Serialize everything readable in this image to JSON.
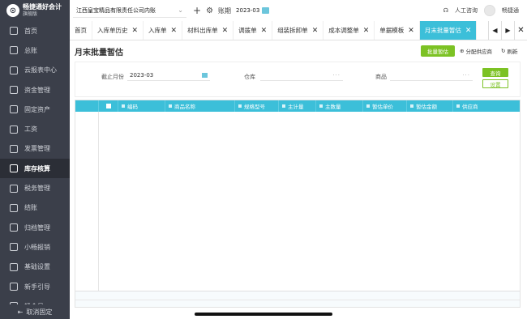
{
  "app": {
    "name": "畅捷通好会计",
    "edition": "旗舰版"
  },
  "sidebar": {
    "items": [
      {
        "label": "首页",
        "icon": "home-icon"
      },
      {
        "label": "总账",
        "icon": "ledger-icon"
      },
      {
        "label": "云报表中心",
        "icon": "report-icon"
      },
      {
        "label": "资金管理",
        "icon": "fund-icon"
      },
      {
        "label": "固定资产",
        "icon": "asset-icon"
      },
      {
        "label": "工资",
        "icon": "salary-icon"
      },
      {
        "label": "发票管理",
        "icon": "invoice-icon"
      },
      {
        "label": "库存核算",
        "icon": "inventory-icon"
      },
      {
        "label": "税务管理",
        "icon": "tax-icon"
      },
      {
        "label": "结账",
        "icon": "closing-icon"
      },
      {
        "label": "归档管理",
        "icon": "archive-icon"
      },
      {
        "label": "小畅报销",
        "icon": "reimburse-icon"
      },
      {
        "label": "基础设置",
        "icon": "settings-icon"
      },
      {
        "label": "新手引导",
        "icon": "guide-icon"
      },
      {
        "label": "畅会员",
        "icon": "member-icon"
      }
    ],
    "active_index": 7,
    "unpin_label": "取消固定"
  },
  "topbar": {
    "company": "江西皇宝精品有限责任公司内账",
    "period_label": "账期",
    "period_value": "2023-03",
    "support_label": "人工咨询",
    "user_name": "畅捷通"
  },
  "tabs": [
    {
      "label": "首页",
      "closable": false
    },
    {
      "label": "入库单历史",
      "closable": true
    },
    {
      "label": "入库单",
      "closable": true
    },
    {
      "label": "材料出库单",
      "closable": true
    },
    {
      "label": "调拨单",
      "closable": true
    },
    {
      "label": "组装拆卸单",
      "closable": true
    },
    {
      "label": "成本调整单",
      "closable": true
    },
    {
      "label": "单据模板",
      "closable": true
    },
    {
      "label": "月末批量暂估",
      "closable": true,
      "active": true
    }
  ],
  "page": {
    "title": "月末批量暂估",
    "batch_button": "批量暂估",
    "allocate_button": "分配供应商",
    "refresh_button": "刷新"
  },
  "filters": {
    "end_month_label": "截止月份",
    "end_month_value": "2023-03",
    "warehouse_label": "仓库",
    "product_label": "商品",
    "query_button": "查询",
    "reset_button": "设置"
  },
  "table": {
    "columns": [
      "编码",
      "商品名称",
      "规格型号",
      "主计量",
      "主数量",
      "暂估单价",
      "暂估金额",
      "供应商"
    ],
    "rows": []
  },
  "colors": {
    "accent": "#3cbfd9",
    "green": "#7cc224",
    "sidebar": "#3b3f4a"
  }
}
